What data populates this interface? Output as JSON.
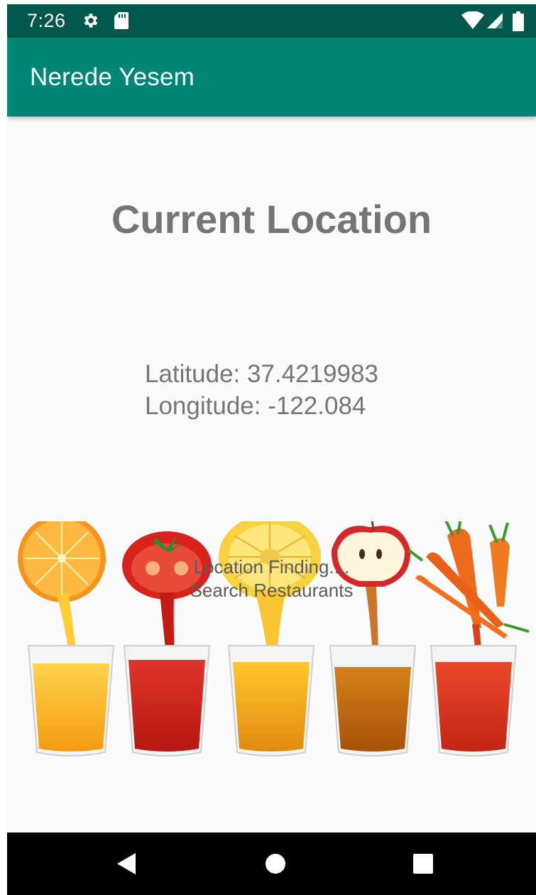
{
  "status_bar": {
    "time": "7:26",
    "icons_left": [
      "gear-icon",
      "sd-card-icon"
    ],
    "icons_right": [
      "wifi-icon",
      "signal-icon",
      "battery-icon"
    ],
    "color": "#00574b"
  },
  "app_bar": {
    "title": "Nerede Yesem",
    "color": "#008577"
  },
  "main": {
    "heading": "Current Location",
    "latitude_text": "Latitude: 37.4219983",
    "longitude_text": "Longitude: -122.084",
    "status_line1": "Location Finding....",
    "status_line2": "Search Restaurants"
  },
  "illustration": {
    "juices": [
      "orange",
      "tomato",
      "pineapple",
      "apple",
      "carrot"
    ]
  },
  "nav_bar": {
    "buttons": [
      "back-icon",
      "home-icon",
      "recents-icon"
    ]
  }
}
